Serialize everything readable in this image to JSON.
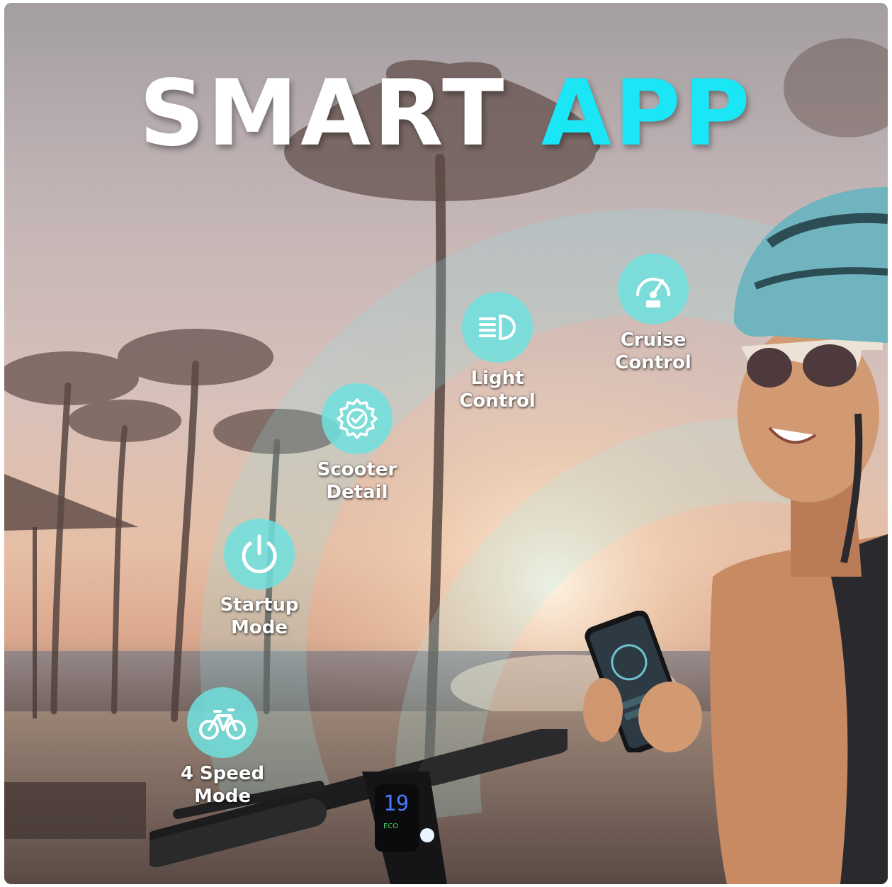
{
  "headline": {
    "word1": "SMART",
    "word2": "APP"
  },
  "features": [
    {
      "id": "cruise",
      "line1": "Cruise",
      "line2": "Control",
      "icon": "speedometer-icon"
    },
    {
      "id": "light",
      "line1": "Light",
      "line2": "Control",
      "icon": "headlight-icon"
    },
    {
      "id": "detail",
      "line1": "Scooter",
      "line2": "Detail",
      "icon": "gear-check-icon"
    },
    {
      "id": "startup",
      "line1": "Startup",
      "line2": "Mode",
      "icon": "power-icon"
    },
    {
      "id": "speed",
      "line1": "4 Speed",
      "line2": "Mode",
      "icon": "bicycle-icon"
    }
  ],
  "scooter_display": {
    "speed": "19",
    "mode": "ECO"
  },
  "colors": {
    "accent": "#1ae6f6",
    "badge": "#70e0de",
    "headline_white": "#ffffff"
  }
}
